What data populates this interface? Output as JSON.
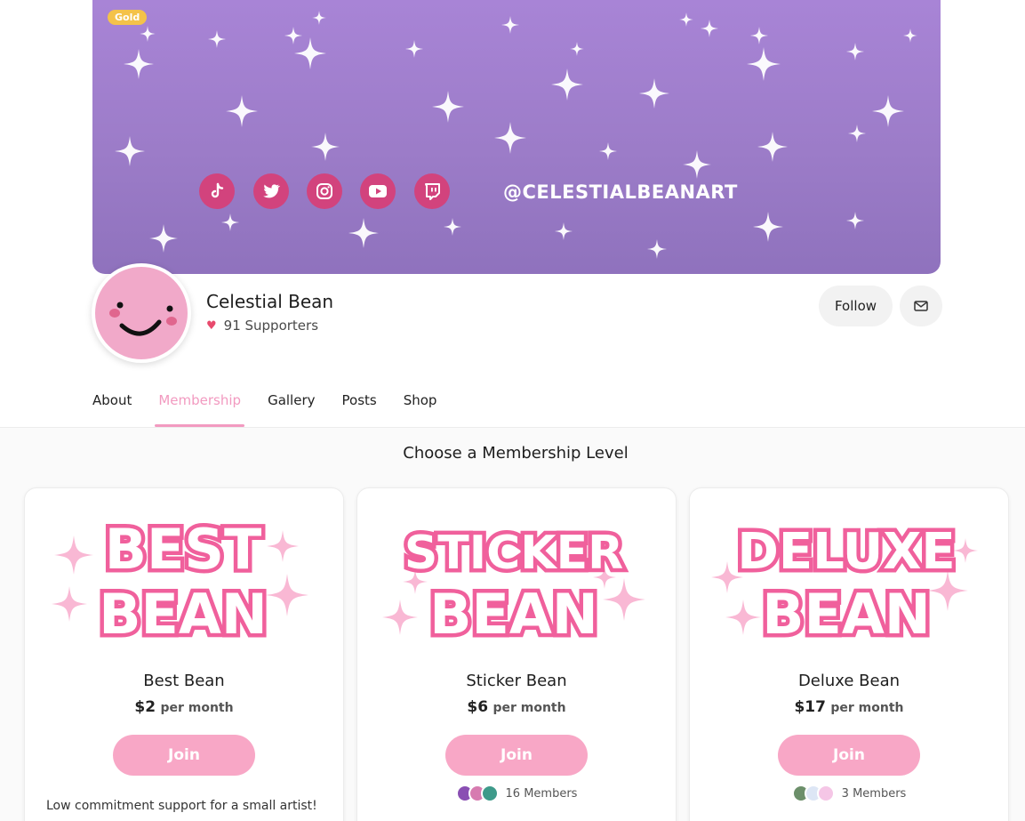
{
  "banner": {
    "badge": "Gold",
    "handle": "@CELESTIALBEANART",
    "socials": [
      "tiktok-icon",
      "twitter-icon",
      "instagram-icon",
      "youtube-icon",
      "twitch-icon"
    ]
  },
  "profile": {
    "name": "Celestial Bean",
    "supporters": "91 Supporters",
    "follow_label": "Follow"
  },
  "tabs": [
    {
      "label": "About"
    },
    {
      "label": "Membership"
    },
    {
      "label": "Gallery"
    },
    {
      "label": "Posts"
    },
    {
      "label": "Shop"
    }
  ],
  "membership": {
    "title": "Choose a Membership Level",
    "tiers": [
      {
        "art_line1": "BEST",
        "art_line2": "BEAN",
        "name": "Best Bean",
        "price": "$2",
        "period": "per month",
        "join_label": "Join",
        "members": "",
        "description": "Low commitment support for a small artist!"
      },
      {
        "art_line1": "STICKER",
        "art_line2": "BEAN",
        "name": "Sticker Bean",
        "price": "$6",
        "period": "per month",
        "join_label": "Join",
        "members": "16 Members"
      },
      {
        "art_line1": "DELUXE",
        "art_line2": "BEAN",
        "name": "Deluxe Bean",
        "price": "$17",
        "period": "per month",
        "join_label": "Join",
        "members": "3 Members"
      }
    ]
  },
  "colors": {
    "accent_pink": "#f29ac0",
    "join_pink": "#f8a7c6",
    "banner_purple": "#a884d6",
    "social_pink": "#d2437d",
    "badge_gold": "#f4c24a"
  }
}
